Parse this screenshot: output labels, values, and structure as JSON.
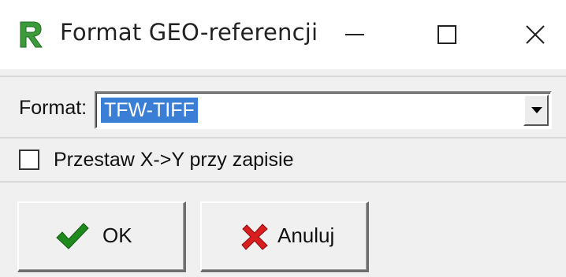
{
  "window": {
    "title": "Format GEO-referencji",
    "icon": "r-app-icon",
    "controls": [
      "minimize-icon",
      "maximize-icon",
      "close-icon"
    ]
  },
  "format": {
    "label": "Format:",
    "selected_value": "TFW-TIFF",
    "dropdown_icon": "chevron-down-icon"
  },
  "swap_option": {
    "label": "Przestaw X->Y przy zapisie",
    "checked": false
  },
  "buttons": {
    "ok_label": "OK",
    "ok_icon": "checkmark-icon",
    "cancel_label": "Anuluj",
    "cancel_icon": "x-mark-icon"
  },
  "colors": {
    "selection": "#3a7fd5",
    "ok_icon": "#1e8a1e",
    "cancel_icon": "#d81e1e",
    "app_icon": "#3c9a3c"
  }
}
